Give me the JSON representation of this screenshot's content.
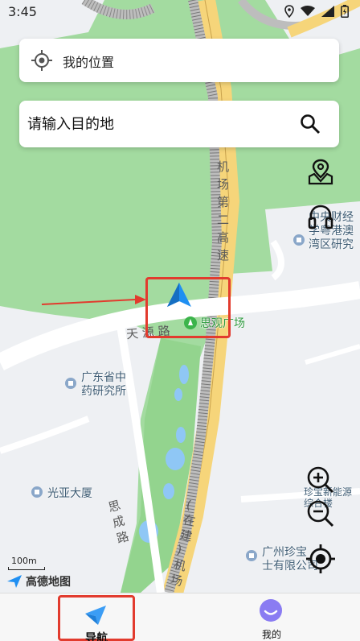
{
  "status_bar": {
    "time": "3:45"
  },
  "my_location": {
    "label": "我的位置"
  },
  "destination": {
    "placeholder": "请输入目的地"
  },
  "map": {
    "poi": {
      "institute_top": [
        "中央财经",
        "学粤港澳",
        "湾区研究"
      ],
      "plaza": "思观广场",
      "tcm_institute": [
        "广东省中",
        "药研究所"
      ],
      "building": "光亚大厦",
      "energy": [
        "珍宝新能源",
        "综合楼"
      ],
      "company": [
        "广州珍宝",
        "士有限公司"
      ]
    },
    "roads": {
      "airport_expressway": [
        "机",
        "场",
        "第",
        "二",
        "高",
        "速"
      ],
      "tianyuan": [
        "天",
        "源",
        "路"
      ],
      "sicheng": [
        "思",
        "成",
        "路"
      ],
      "under_construction": [
        "(",
        "在",
        "建",
        ")",
        "机",
        "场"
      ]
    },
    "scale": "100m",
    "logo": "高德地图"
  },
  "bottom_nav": {
    "tabs": [
      {
        "label": "导航"
      },
      {
        "label": "我的"
      }
    ]
  },
  "colors": {
    "accent": "#1f8ff2",
    "highlight": "#e23b2e"
  }
}
